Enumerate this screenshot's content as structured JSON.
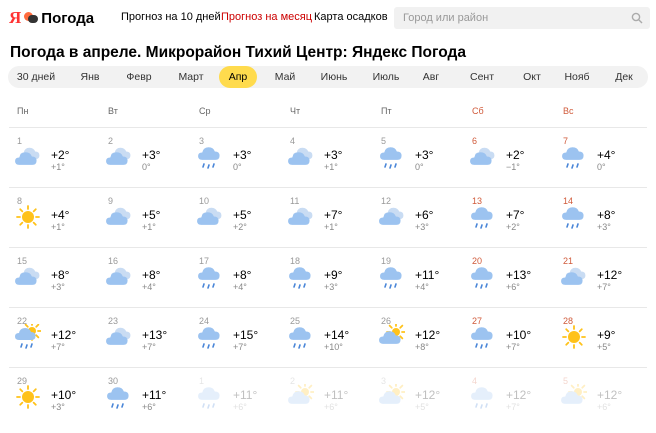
{
  "header": {
    "logo_ya": "Я",
    "logo_text": "Погода",
    "nav": [
      "Прогноз на 10 дней",
      "Прогноз на месяц",
      "Карта осадков"
    ],
    "active_nav": 1,
    "search_placeholder": "Город или район",
    "search_icon": "search-icon"
  },
  "page_title": "Погода в апреле. Микрорайон Тихий Центр: Яндекс Погода",
  "tabs": [
    "30 дней",
    "Янв",
    "Февр",
    "Март",
    "Апр",
    "Май",
    "Июнь",
    "Июль",
    "Авг",
    "Сент",
    "Окт",
    "Нояб",
    "Дек"
  ],
  "active_tab": 4,
  "colors": {
    "accent_yellow": "#ffdb4d",
    "active_nav_red": "#cc0000",
    "weekend_red": "#d05a3a",
    "cloud_blue": "#9cc3f0",
    "sun_yellow": "#ffc21a"
  },
  "weekdays": [
    "Пн",
    "Вт",
    "Ср",
    "Чт",
    "Пт",
    "Сб",
    "Вс"
  ],
  "weeks": [
    [
      {
        "d": "1",
        "max": "+2°",
        "min": "+1°",
        "icon": "cloudy"
      },
      {
        "d": "2",
        "max": "+3°",
        "min": "0°",
        "icon": "cloudy"
      },
      {
        "d": "3",
        "max": "+3°",
        "min": "0°",
        "icon": "cloud-rain"
      },
      {
        "d": "4",
        "max": "+3°",
        "min": "+1°",
        "icon": "cloudy"
      },
      {
        "d": "5",
        "max": "+3°",
        "min": "0°",
        "icon": "cloud-rain"
      },
      {
        "d": "6",
        "max": "+2°",
        "min": "−1°",
        "icon": "cloudy"
      },
      {
        "d": "7",
        "max": "+4°",
        "min": "0°",
        "icon": "cloud-rain"
      }
    ],
    [
      {
        "d": "8",
        "max": "+4°",
        "min": "+1°",
        "icon": "sun"
      },
      {
        "d": "9",
        "max": "+5°",
        "min": "+1°",
        "icon": "cloudy"
      },
      {
        "d": "10",
        "max": "+5°",
        "min": "+2°",
        "icon": "cloudy"
      },
      {
        "d": "11",
        "max": "+7°",
        "min": "+1°",
        "icon": "cloudy"
      },
      {
        "d": "12",
        "max": "+6°",
        "min": "+3°",
        "icon": "cloudy"
      },
      {
        "d": "13",
        "max": "+7°",
        "min": "+2°",
        "icon": "cloud-rain"
      },
      {
        "d": "14",
        "max": "+8°",
        "min": "+3°",
        "icon": "cloud-rain"
      }
    ],
    [
      {
        "d": "15",
        "max": "+8°",
        "min": "+3°",
        "icon": "cloudy"
      },
      {
        "d": "16",
        "max": "+8°",
        "min": "+4°",
        "icon": "cloudy"
      },
      {
        "d": "17",
        "max": "+8°",
        "min": "+4°",
        "icon": "cloud-rain"
      },
      {
        "d": "18",
        "max": "+9°",
        "min": "+3°",
        "icon": "cloud-rain"
      },
      {
        "d": "19",
        "max": "+11°",
        "min": "+4°",
        "icon": "cloud-rain"
      },
      {
        "d": "20",
        "max": "+13°",
        "min": "+6°",
        "icon": "cloud-rain"
      },
      {
        "d": "21",
        "max": "+12°",
        "min": "+7°",
        "icon": "cloudy"
      }
    ],
    [
      {
        "d": "22",
        "max": "+12°",
        "min": "+7°",
        "icon": "sun-cloud-rain"
      },
      {
        "d": "23",
        "max": "+13°",
        "min": "+7°",
        "icon": "cloudy"
      },
      {
        "d": "24",
        "max": "+15°",
        "min": "+7°",
        "icon": "cloud-rain"
      },
      {
        "d": "25",
        "max": "+14°",
        "min": "+10°",
        "icon": "cloud-rain"
      },
      {
        "d": "26",
        "max": "+12°",
        "min": "+8°",
        "icon": "sun-cloud"
      },
      {
        "d": "27",
        "max": "+10°",
        "min": "+7°",
        "icon": "cloud-rain"
      },
      {
        "d": "28",
        "max": "+9°",
        "min": "+5°",
        "icon": "sun"
      }
    ],
    [
      {
        "d": "29",
        "max": "+10°",
        "min": "+3°",
        "icon": "sun"
      },
      {
        "d": "30",
        "max": "+11°",
        "min": "+6°",
        "icon": "cloud-rain"
      },
      {
        "d": "1",
        "max": "+11°",
        "min": "+6°",
        "icon": "cloud-rain",
        "faded": true
      },
      {
        "d": "2",
        "max": "+11°",
        "min": "+6°",
        "icon": "sun-cloud",
        "faded": true
      },
      {
        "d": "3",
        "max": "+12°",
        "min": "+5°",
        "icon": "sun-cloud",
        "faded": true
      },
      {
        "d": "4",
        "max": "+12°",
        "min": "+7°",
        "icon": "cloud-rain",
        "faded": true
      },
      {
        "d": "5",
        "max": "+12°",
        "min": "+6°",
        "icon": "sun-cloud",
        "faded": true
      }
    ]
  ]
}
